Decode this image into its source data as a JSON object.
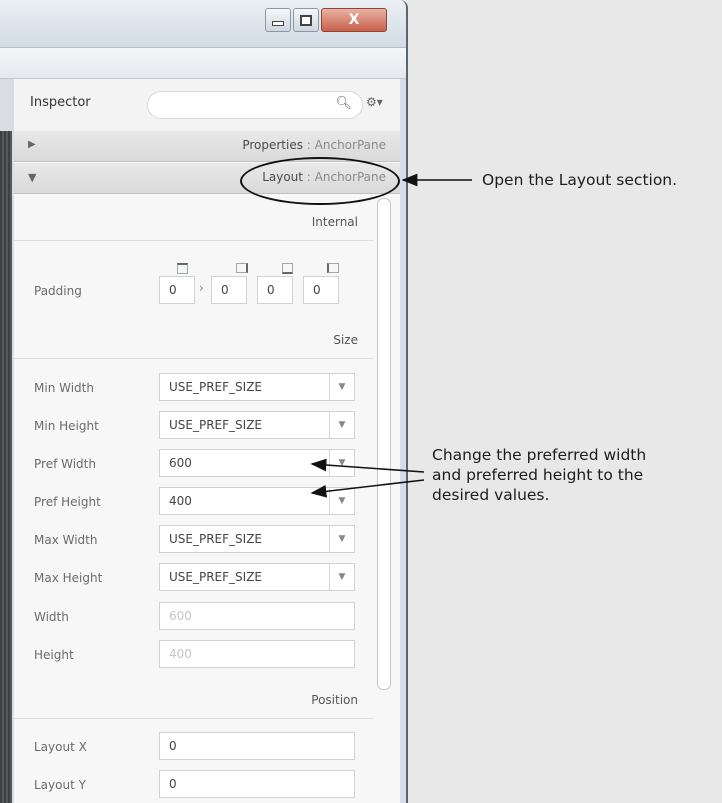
{
  "window": {
    "close_glyph": "X"
  },
  "inspector": {
    "title": "Inspector",
    "search_placeholder": "",
    "sections": [
      {
        "name": "Properties",
        "type": "AnchorPane",
        "expanded": false
      },
      {
        "name": "Layout",
        "type": "AnchorPane",
        "expanded": true
      }
    ],
    "separator": " : "
  },
  "layout": {
    "groups": {
      "internal": "Internal",
      "size": "Size",
      "position": "Position"
    },
    "padding": {
      "label": "Padding",
      "values": [
        "0",
        "0",
        "0",
        "0"
      ]
    },
    "size_rows": [
      {
        "label": "Min Width",
        "value": "USE_PREF_SIZE",
        "editable": true
      },
      {
        "label": "Min Height",
        "value": "USE_PREF_SIZE",
        "editable": true
      },
      {
        "label": "Pref Width",
        "value": "600",
        "editable": true
      },
      {
        "label": "Pref Height",
        "value": "400",
        "editable": true
      },
      {
        "label": "Max Width",
        "value": "USE_PREF_SIZE",
        "editable": true
      },
      {
        "label": "Max Height",
        "value": "USE_PREF_SIZE",
        "editable": true
      },
      {
        "label": "Width",
        "value": "600",
        "editable": false
      },
      {
        "label": "Height",
        "value": "400",
        "editable": false
      }
    ],
    "position_rows": [
      {
        "label": "Layout X",
        "value": "0"
      },
      {
        "label": "Layout Y",
        "value": "0"
      }
    ]
  },
  "annotations": {
    "open_layout": "Open the Layout section.",
    "change_pref": [
      "Change the preferred width",
      "and preferred height to the",
      "desired values."
    ]
  }
}
